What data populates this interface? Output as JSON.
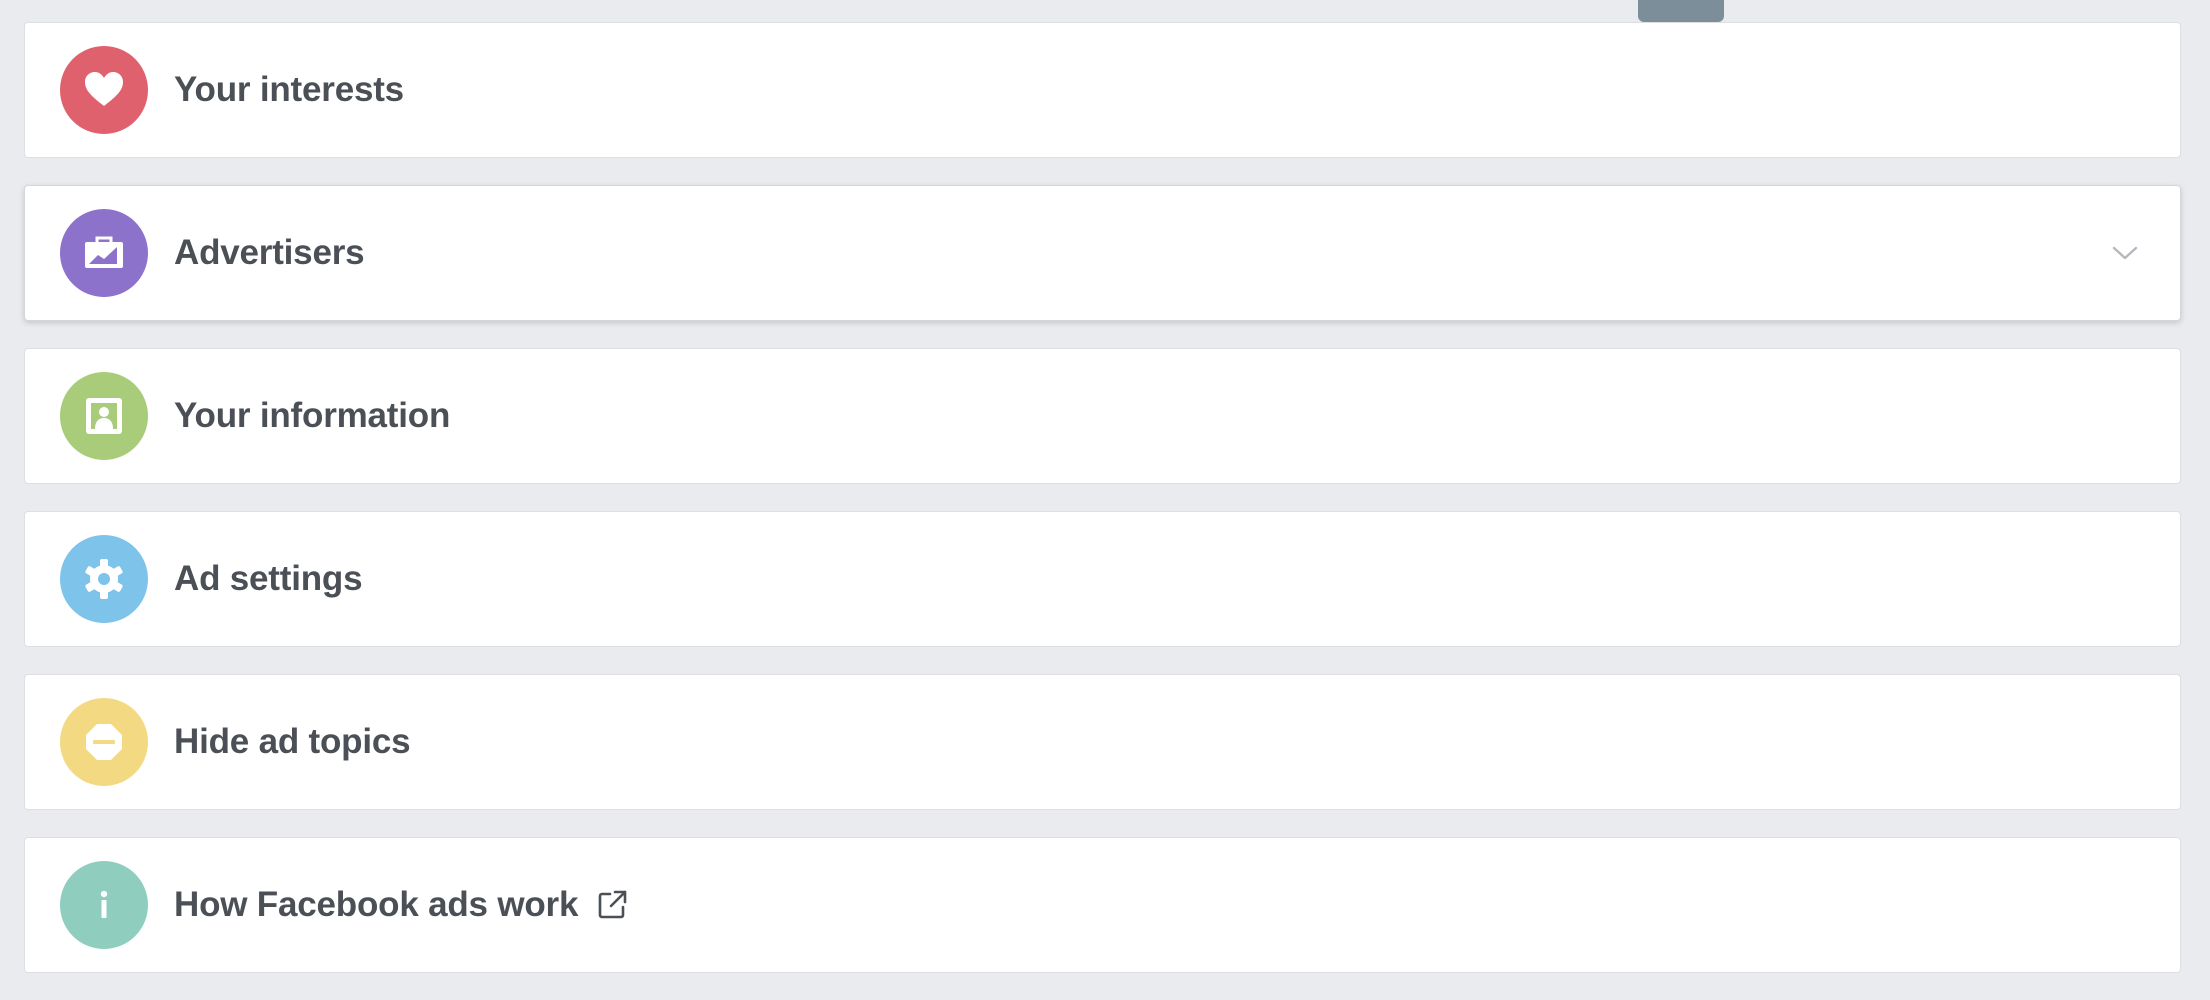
{
  "sections": [
    {
      "label": "Your interests",
      "icon": "heart-icon",
      "color": "#e0616e"
    },
    {
      "label": "Advertisers",
      "icon": "briefcase-icon",
      "color": "#8c72cb"
    },
    {
      "label": "Your information",
      "icon": "profile-card-icon",
      "color": "#a8cc79"
    },
    {
      "label": "Ad settings",
      "icon": "gear-icon",
      "color": "#7ec3ea"
    },
    {
      "label": "Hide ad topics",
      "icon": "no-entry-icon",
      "color": "#f4d983"
    },
    {
      "label": "How Facebook ads work",
      "icon": "info-icon",
      "color": "#8fcebf"
    }
  ],
  "colors": {
    "background": "#e9ebee",
    "card": "#ffffff",
    "text": "#4b4f56"
  }
}
